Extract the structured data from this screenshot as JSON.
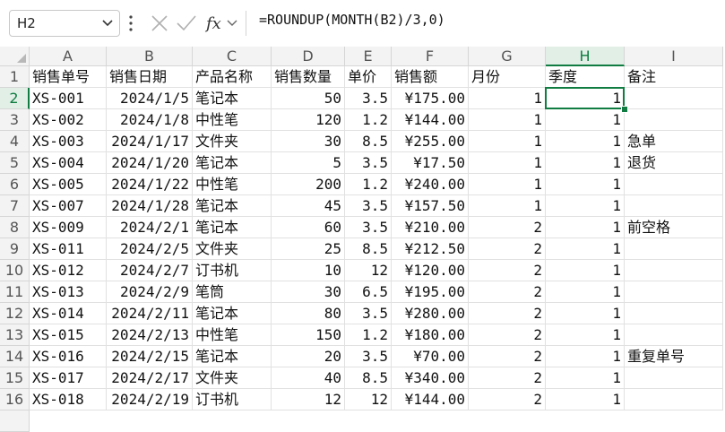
{
  "formula_bar": {
    "name_box": "H2",
    "formula": "=ROUNDUP(MONTH(B2)/3,0)",
    "fx_label": "fx"
  },
  "sheet": {
    "selected_cell": "H2",
    "accent_color": "#107c41",
    "columns": [
      {
        "label": "A",
        "type": "code"
      },
      {
        "label": "B",
        "type": "num"
      },
      {
        "label": "C",
        "type": "txt"
      },
      {
        "label": "D",
        "type": "num"
      },
      {
        "label": "E",
        "type": "num"
      },
      {
        "label": "F",
        "type": "num"
      },
      {
        "label": "G",
        "type": "num"
      },
      {
        "label": "H",
        "type": "num"
      },
      {
        "label": "I",
        "type": "txt"
      }
    ],
    "row_numbers": [
      "1",
      "2",
      "3",
      "4",
      "5",
      "6",
      "7",
      "8",
      "9",
      "10",
      "11",
      "12",
      "13",
      "14",
      "15",
      "16"
    ],
    "header_row": [
      "销售单号",
      "销售日期",
      "产品名称",
      "销售数量",
      "单价",
      "销售额",
      "月份",
      "季度",
      "备注"
    ],
    "rows": [
      [
        "XS-001",
        "2024/1/5",
        "笔记本",
        "50",
        "3.5",
        "¥175.00",
        "1",
        "1",
        ""
      ],
      [
        "XS-002",
        "2024/1/8",
        "中性笔",
        "120",
        "1.2",
        "¥144.00",
        "1",
        "1",
        ""
      ],
      [
        "XS-003",
        "2024/1/17",
        "文件夹",
        "30",
        "8.5",
        "¥255.00",
        "1",
        "1",
        "急单"
      ],
      [
        "XS-004",
        "2024/1/20",
        "笔记本",
        "5",
        "3.5",
        "¥17.50",
        "1",
        "1",
        "退货"
      ],
      [
        "XS-005",
        "2024/1/22",
        "中性笔",
        "200",
        "1.2",
        "¥240.00",
        "1",
        "1",
        ""
      ],
      [
        "XS-007",
        "2024/1/28",
        "笔记本",
        "45",
        "3.5",
        "¥157.50",
        "1",
        "1",
        ""
      ],
      [
        "XS-009",
        "2024/2/1",
        "笔记本",
        "60",
        "3.5",
        "¥210.00",
        "2",
        "1",
        "前空格"
      ],
      [
        "XS-011",
        "2024/2/5",
        "文件夹",
        "25",
        "8.5",
        "¥212.50",
        "2",
        "1",
        ""
      ],
      [
        "XS-012",
        "2024/2/7",
        "订书机",
        "10",
        "12",
        "¥120.00",
        "2",
        "1",
        ""
      ],
      [
        "XS-013",
        "2024/2/9",
        "笔筒",
        "30",
        "6.5",
        "¥195.00",
        "2",
        "1",
        ""
      ],
      [
        "XS-014",
        "2024/2/11",
        "笔记本",
        "80",
        "3.5",
        "¥280.00",
        "2",
        "1",
        ""
      ],
      [
        "XS-015",
        "2024/2/13",
        "中性笔",
        "150",
        "1.2",
        "¥180.00",
        "2",
        "1",
        ""
      ],
      [
        "XS-016",
        "2024/2/15",
        "笔记本",
        "20",
        "3.5",
        "¥70.00",
        "2",
        "1",
        "重复单号"
      ],
      [
        "XS-017",
        "2024/2/17",
        "文件夹",
        "40",
        "8.5",
        "¥340.00",
        "2",
        "1",
        ""
      ],
      [
        "XS-018",
        "2024/2/19",
        "订书机",
        "12",
        "12",
        "¥144.00",
        "2",
        "1",
        ""
      ]
    ]
  }
}
